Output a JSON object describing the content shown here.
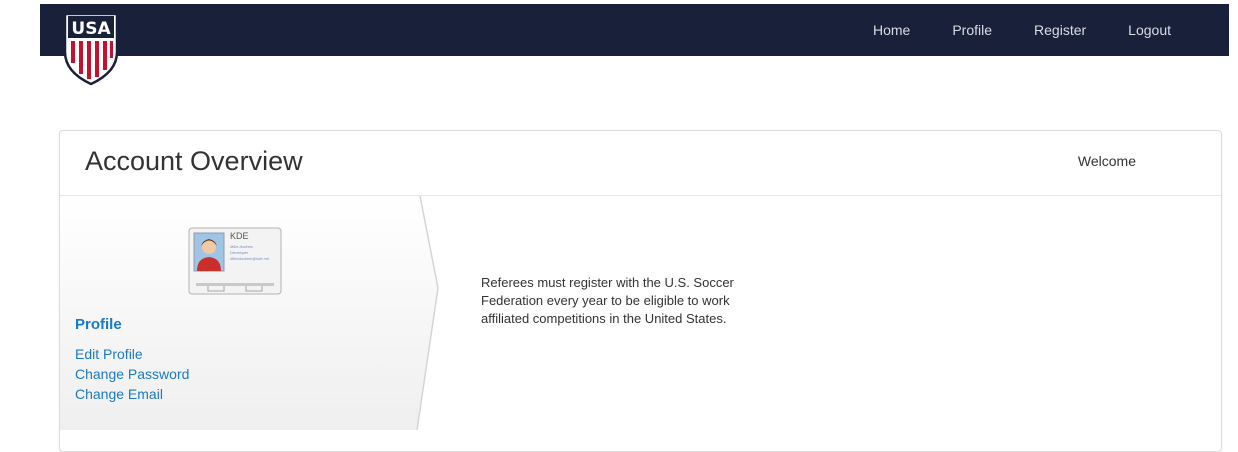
{
  "nav": {
    "logo_text": "USA",
    "links": [
      {
        "label": "Home"
      },
      {
        "label": "Profile"
      },
      {
        "label": "Register"
      },
      {
        "label": "Logout"
      }
    ]
  },
  "panel": {
    "title": "Account Overview",
    "welcome": "Welcome"
  },
  "sidebar": {
    "card": {
      "name": "KDE",
      "lines": [
        "Mike Andrew",
        "Developer",
        "MikeAndrew@kde.net"
      ]
    },
    "heading": "Profile",
    "links": [
      {
        "label": "Edit Profile"
      },
      {
        "label": "Change Password"
      },
      {
        "label": "Change Email"
      }
    ]
  },
  "intro_text": "Referees must register with the U.S. Soccer Federation every year to be eligible to work affiliated competitions in the United States.",
  "colors": {
    "navbar": "#19203a",
    "link": "#1a7ac9",
    "logo_red": "#c8102e",
    "logo_navy": "#19203a"
  }
}
